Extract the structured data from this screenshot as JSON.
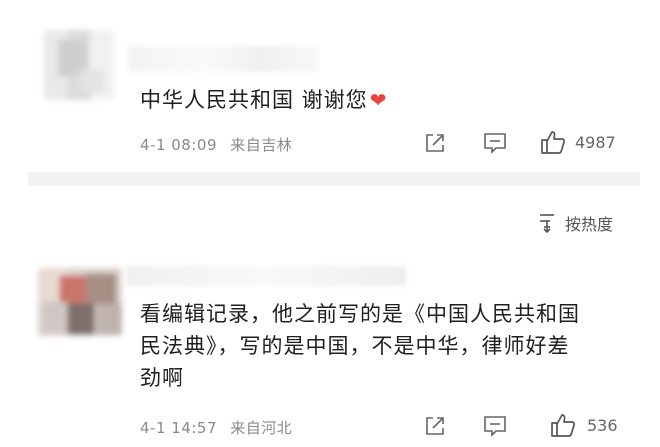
{
  "comments": [
    {
      "text": "中华人民共和国 谢谢您",
      "emoji": "❤",
      "time": "4-1 08:09",
      "location": "来自吉林",
      "likes": "4987"
    },
    {
      "text_line1": "看编辑记录，他之前写的是《中国人民共和国",
      "text_line2": "民法典》，写的是中国，不是中华，律师好差",
      "text_line3": "劲啊",
      "time": "4-1 14:57",
      "location": "来自河北",
      "likes": "536"
    }
  ],
  "sort": {
    "label": "按热度"
  },
  "icons": {
    "share": "share-icon",
    "comment": "comment-icon",
    "like": "thumbs-up-icon",
    "sort": "sort-icon"
  }
}
